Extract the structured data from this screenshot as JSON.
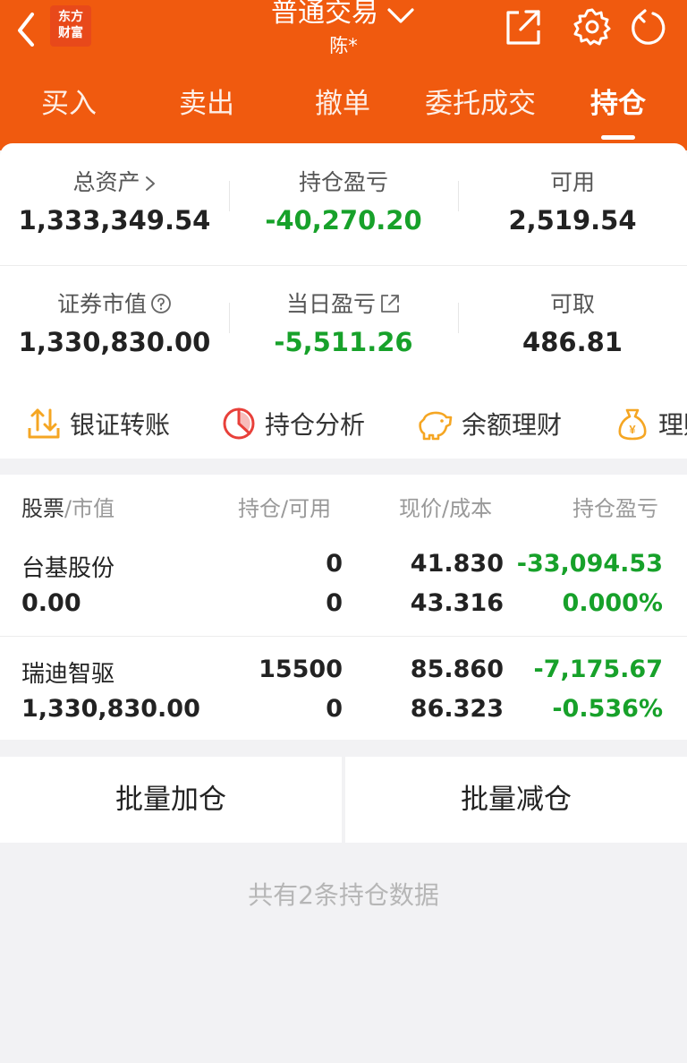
{
  "header": {
    "logo_line1": "东方",
    "logo_line2": "财富",
    "title": "普通交易",
    "subtitle": "陈*"
  },
  "tabs": [
    {
      "label": "买入"
    },
    {
      "label": "卖出"
    },
    {
      "label": "撤单"
    },
    {
      "label": "委托成交"
    },
    {
      "label": "持仓"
    }
  ],
  "summary": {
    "total_assets_label": "总资产",
    "total_assets": "1,333,349.54",
    "position_pl_label": "持仓盈亏",
    "position_pl": "-40,270.20",
    "available_label": "可用",
    "available": "2,519.54",
    "market_value_label": "证券市值",
    "market_value": "1,330,830.00",
    "daily_pl_label": "当日盈亏",
    "daily_pl": "-5,511.26",
    "withdrawable_label": "可取",
    "withdrawable": "486.81"
  },
  "actions": [
    {
      "label": "银证转账",
      "icon": "transfer-icon"
    },
    {
      "label": "持仓分析",
      "icon": "pie-chart-icon"
    },
    {
      "label": "余额理财",
      "icon": "piggy-bank-icon"
    },
    {
      "label": "理财",
      "icon": "money-bag-icon"
    }
  ],
  "table": {
    "col1_a": "股票",
    "col1_b": "市值",
    "col2_a": "持仓",
    "col2_b": "可用",
    "col3_a": "现价",
    "col3_b": "成本",
    "col4": "持仓盈亏",
    "rows": [
      {
        "name": "台基股份",
        "market_value": "0.00",
        "position": "0",
        "available": "0",
        "price": "41.830",
        "cost": "43.316",
        "pl": "-33,094.53",
        "pl_pct": "0.000%"
      },
      {
        "name": "瑞迪智驱",
        "market_value": "1,330,830.00",
        "position": "15500",
        "available": "0",
        "price": "85.860",
        "cost": "86.323",
        "pl": "-7,175.67",
        "pl_pct": "-0.536%"
      }
    ]
  },
  "batch": {
    "add_label": "批量加仓",
    "reduce_label": "批量减仓"
  },
  "footer_note": "共有2条持仓数据",
  "colors": {
    "brand": "#f05a0f",
    "loss_green": "#17a12a",
    "icon_orange": "#f5a623",
    "icon_red": "#e8403a"
  }
}
